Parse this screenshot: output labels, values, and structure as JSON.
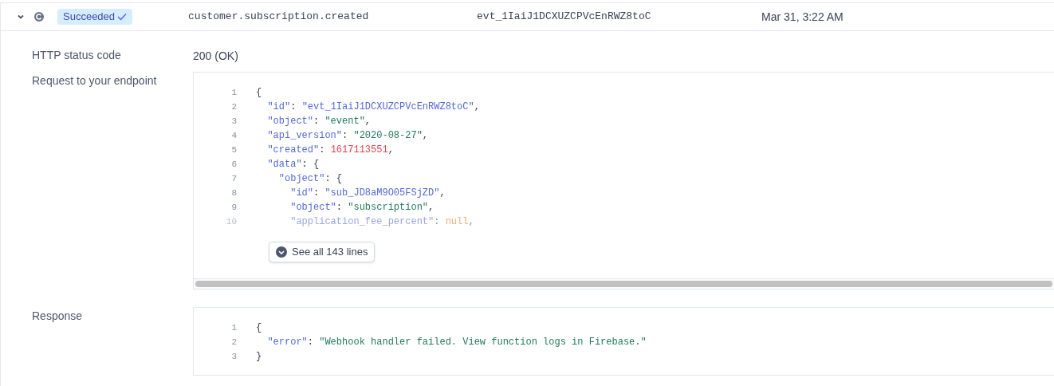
{
  "event": {
    "expanded": true,
    "status": "Succeeded",
    "type": "customer.subscription.created",
    "id": "evt_1IaiJ1DCXUZCPVcEnRWZ8toC",
    "time": "Mar 31, 3:22 AM"
  },
  "details": [
    {
      "kind": "text",
      "label": "HTTP status code",
      "value": "200 (OK)"
    },
    {
      "kind": "code",
      "label": "Request to your endpoint",
      "more": "See all 143 lines",
      "lines": [
        {
          "number": "1",
          "faded": false,
          "tokens": [
            {
              "kind": "punct",
              "text": "{"
            }
          ]
        },
        {
          "number": "2",
          "faded": false,
          "tokens": [
            {
              "kind": "key",
              "text": "  \"id\""
            },
            {
              "kind": "punct",
              "text": ": "
            },
            {
              "kind": "key",
              "text": "\"evt_1IaiJ1DCXUZCPVcEnRWZ8toC\""
            },
            {
              "kind": "punct",
              "text": ","
            }
          ]
        },
        {
          "number": "3",
          "faded": false,
          "tokens": [
            {
              "kind": "key",
              "text": "  \"object\""
            },
            {
              "kind": "punct",
              "text": ": "
            },
            {
              "kind": "string",
              "text": "\"event\""
            },
            {
              "kind": "punct",
              "text": ","
            }
          ]
        },
        {
          "number": "4",
          "faded": false,
          "tokens": [
            {
              "kind": "key",
              "text": "  \"api_version\""
            },
            {
              "kind": "punct",
              "text": ": "
            },
            {
              "kind": "string",
              "text": "\"2020-08-27\""
            },
            {
              "kind": "punct",
              "text": ","
            }
          ]
        },
        {
          "number": "5",
          "faded": false,
          "tokens": [
            {
              "kind": "key",
              "text": "  \"created\""
            },
            {
              "kind": "punct",
              "text": ": "
            },
            {
              "kind": "number",
              "text": "1617113551"
            },
            {
              "kind": "punct",
              "text": ","
            }
          ]
        },
        {
          "number": "6",
          "faded": false,
          "tokens": [
            {
              "kind": "key",
              "text": "  \"data\""
            },
            {
              "kind": "punct",
              "text": ": {"
            }
          ]
        },
        {
          "number": "7",
          "faded": false,
          "tokens": [
            {
              "kind": "key",
              "text": "    \"object\""
            },
            {
              "kind": "punct",
              "text": ": {"
            }
          ]
        },
        {
          "number": "8",
          "faded": false,
          "tokens": [
            {
              "kind": "key",
              "text": "      \"id\""
            },
            {
              "kind": "punct",
              "text": ": "
            },
            {
              "kind": "key",
              "text": "\"sub_JD8aM9O05FSjZD\""
            },
            {
              "kind": "punct",
              "text": ","
            }
          ]
        },
        {
          "number": "9",
          "faded": false,
          "tokens": [
            {
              "kind": "key",
              "text": "      \"object\""
            },
            {
              "kind": "punct",
              "text": ": "
            },
            {
              "kind": "string",
              "text": "\"subscription\""
            },
            {
              "kind": "punct",
              "text": ","
            }
          ]
        },
        {
          "number": "10",
          "faded": true,
          "tokens": [
            {
              "kind": "key",
              "text": "      \"application_fee_percent\""
            },
            {
              "kind": "punct",
              "text": ": "
            },
            {
              "kind": "null",
              "text": "null"
            },
            {
              "kind": "punct",
              "text": ","
            }
          ]
        }
      ]
    },
    {
      "kind": "code",
      "label": "Response",
      "lines": [
        {
          "number": "1",
          "faded": false,
          "tokens": [
            {
              "kind": "punct",
              "text": "{"
            }
          ]
        },
        {
          "number": "2",
          "faded": false,
          "tokens": [
            {
              "kind": "key",
              "text": "  \"error\""
            },
            {
              "kind": "punct",
              "text": ": "
            },
            {
              "kind": "string",
              "text": "\"Webhook handler failed. View function logs in Firebase.\""
            }
          ]
        },
        {
          "number": "3",
          "faded": false,
          "tokens": [
            {
              "kind": "punct",
              "text": "}"
            }
          ]
        }
      ]
    }
  ]
}
